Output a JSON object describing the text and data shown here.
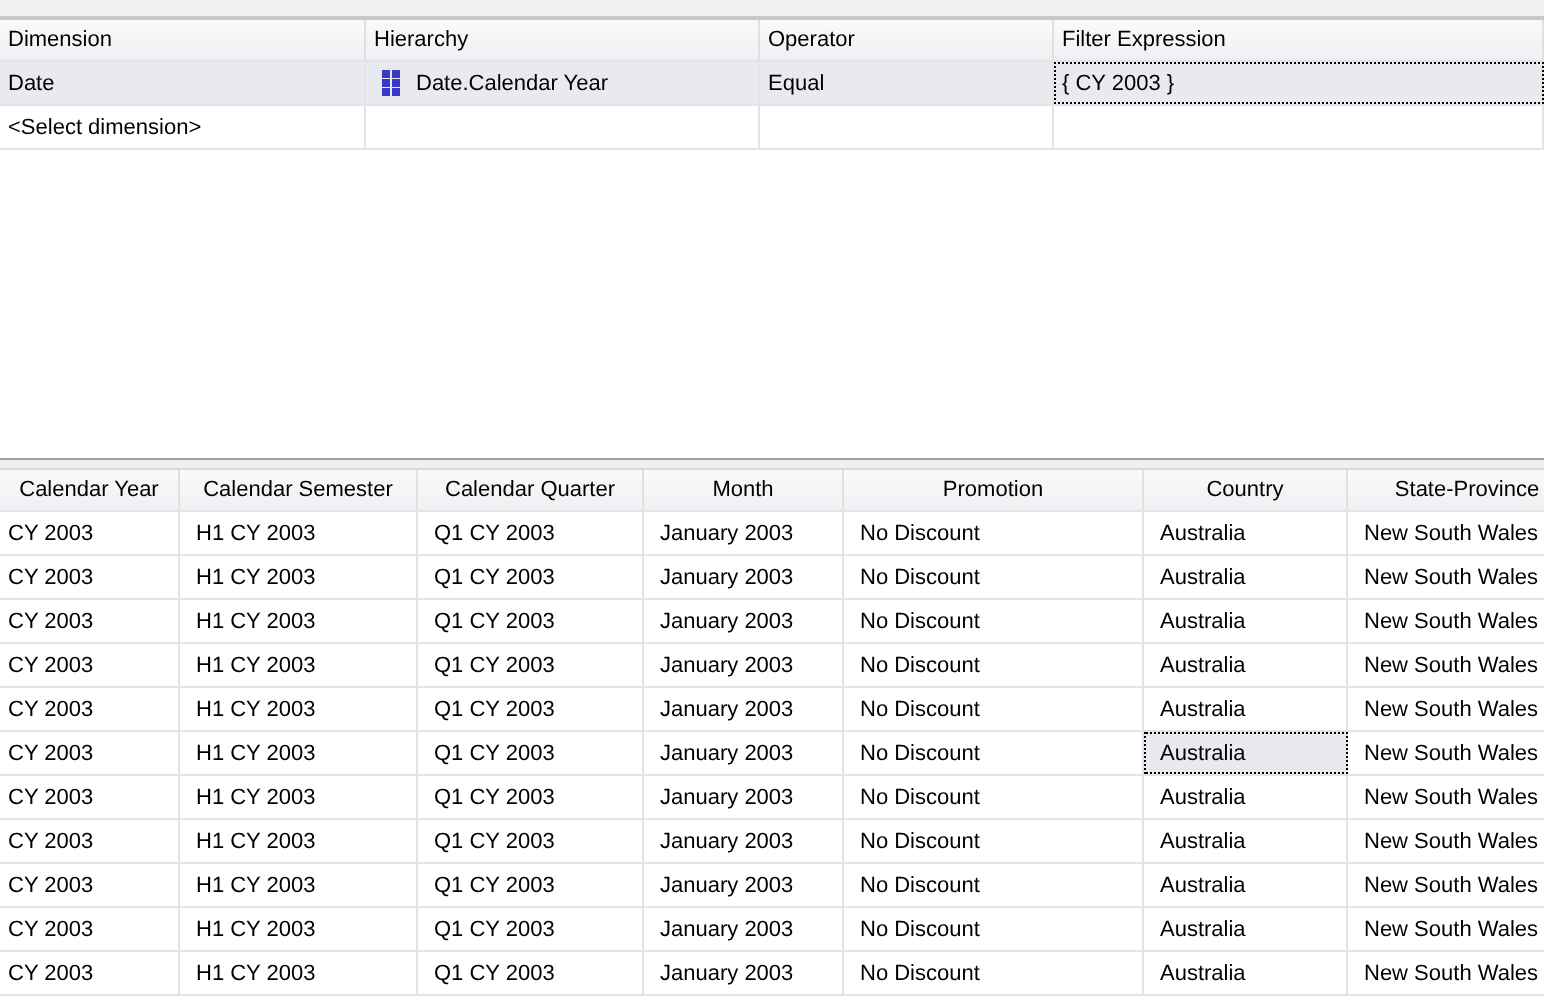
{
  "filter_grid": {
    "columns": [
      "Dimension",
      "Hierarchy",
      "Operator",
      "Filter Expression"
    ],
    "rows": [
      {
        "selected": true,
        "cells": [
          {
            "text": "Date",
            "focused": false
          },
          {
            "text": "Date.Calendar Year",
            "focused": false,
            "icon": true
          },
          {
            "text": "Equal",
            "focused": false
          },
          {
            "text": "{ CY 2003 }",
            "focused": true
          }
        ]
      },
      {
        "selected": false,
        "cells": [
          {
            "text": "<Select dimension>",
            "focused": false
          },
          {
            "text": "",
            "focused": false
          },
          {
            "text": "",
            "focused": false
          },
          {
            "text": "",
            "focused": false
          }
        ]
      }
    ]
  },
  "result_grid": {
    "columns": [
      "Calendar Year",
      "Calendar Semester",
      "Calendar Quarter",
      "Month",
      "Promotion",
      "Country",
      "State-Province"
    ],
    "rows": [
      {
        "cells": [
          {
            "text": "CY 2003",
            "focused": false
          },
          {
            "text": "H1 CY 2003",
            "focused": false
          },
          {
            "text": "Q1 CY 2003",
            "focused": false
          },
          {
            "text": "January 2003",
            "focused": false
          },
          {
            "text": "No Discount",
            "focused": false
          },
          {
            "text": "Australia",
            "focused": false
          },
          {
            "text": "New South Wales",
            "focused": false
          }
        ]
      },
      {
        "cells": [
          {
            "text": "CY 2003",
            "focused": false
          },
          {
            "text": "H1 CY 2003",
            "focused": false
          },
          {
            "text": "Q1 CY 2003",
            "focused": false
          },
          {
            "text": "January 2003",
            "focused": false
          },
          {
            "text": "No Discount",
            "focused": false
          },
          {
            "text": "Australia",
            "focused": false
          },
          {
            "text": "New South Wales",
            "focused": false
          }
        ]
      },
      {
        "cells": [
          {
            "text": "CY 2003",
            "focused": false
          },
          {
            "text": "H1 CY 2003",
            "focused": false
          },
          {
            "text": "Q1 CY 2003",
            "focused": false
          },
          {
            "text": "January 2003",
            "focused": false
          },
          {
            "text": "No Discount",
            "focused": false
          },
          {
            "text": "Australia",
            "focused": false
          },
          {
            "text": "New South Wales",
            "focused": false
          }
        ]
      },
      {
        "cells": [
          {
            "text": "CY 2003",
            "focused": false
          },
          {
            "text": "H1 CY 2003",
            "focused": false
          },
          {
            "text": "Q1 CY 2003",
            "focused": false
          },
          {
            "text": "January 2003",
            "focused": false
          },
          {
            "text": "No Discount",
            "focused": false
          },
          {
            "text": "Australia",
            "focused": false
          },
          {
            "text": "New South Wales",
            "focused": false
          }
        ]
      },
      {
        "cells": [
          {
            "text": "CY 2003",
            "focused": false
          },
          {
            "text": "H1 CY 2003",
            "focused": false
          },
          {
            "text": "Q1 CY 2003",
            "focused": false
          },
          {
            "text": "January 2003",
            "focused": false
          },
          {
            "text": "No Discount",
            "focused": false
          },
          {
            "text": "Australia",
            "focused": false
          },
          {
            "text": "New South Wales",
            "focused": false
          }
        ]
      },
      {
        "cells": [
          {
            "text": "CY 2003",
            "focused": false
          },
          {
            "text": "H1 CY 2003",
            "focused": false
          },
          {
            "text": "Q1 CY 2003",
            "focused": false
          },
          {
            "text": "January 2003",
            "focused": false
          },
          {
            "text": "No Discount",
            "focused": false
          },
          {
            "text": "Australia",
            "focused": true
          },
          {
            "text": "New South Wales",
            "focused": false
          }
        ]
      },
      {
        "cells": [
          {
            "text": "CY 2003",
            "focused": false
          },
          {
            "text": "H1 CY 2003",
            "focused": false
          },
          {
            "text": "Q1 CY 2003",
            "focused": false
          },
          {
            "text": "January 2003",
            "focused": false
          },
          {
            "text": "No Discount",
            "focused": false
          },
          {
            "text": "Australia",
            "focused": false
          },
          {
            "text": "New South Wales",
            "focused": false
          }
        ]
      },
      {
        "cells": [
          {
            "text": "CY 2003",
            "focused": false
          },
          {
            "text": "H1 CY 2003",
            "focused": false
          },
          {
            "text": "Q1 CY 2003",
            "focused": false
          },
          {
            "text": "January 2003",
            "focused": false
          },
          {
            "text": "No Discount",
            "focused": false
          },
          {
            "text": "Australia",
            "focused": false
          },
          {
            "text": "New South Wales",
            "focused": false
          }
        ]
      },
      {
        "cells": [
          {
            "text": "CY 2003",
            "focused": false
          },
          {
            "text": "H1 CY 2003",
            "focused": false
          },
          {
            "text": "Q1 CY 2003",
            "focused": false
          },
          {
            "text": "January 2003",
            "focused": false
          },
          {
            "text": "No Discount",
            "focused": false
          },
          {
            "text": "Australia",
            "focused": false
          },
          {
            "text": "New South Wales",
            "focused": false
          }
        ]
      },
      {
        "cells": [
          {
            "text": "CY 2003",
            "focused": false
          },
          {
            "text": "H1 CY 2003",
            "focused": false
          },
          {
            "text": "Q1 CY 2003",
            "focused": false
          },
          {
            "text": "January 2003",
            "focused": false
          },
          {
            "text": "No Discount",
            "focused": false
          },
          {
            "text": "Australia",
            "focused": false
          },
          {
            "text": "New South Wales",
            "focused": false
          }
        ]
      },
      {
        "cells": [
          {
            "text": "CY 2003",
            "focused": false
          },
          {
            "text": "H1 CY 2003",
            "focused": false
          },
          {
            "text": "Q1 CY 2003",
            "focused": false
          },
          {
            "text": "January 2003",
            "focused": false
          },
          {
            "text": "No Discount",
            "focused": false
          },
          {
            "text": "Australia",
            "focused": false
          },
          {
            "text": "New South Wales",
            "focused": false
          }
        ]
      }
    ]
  }
}
